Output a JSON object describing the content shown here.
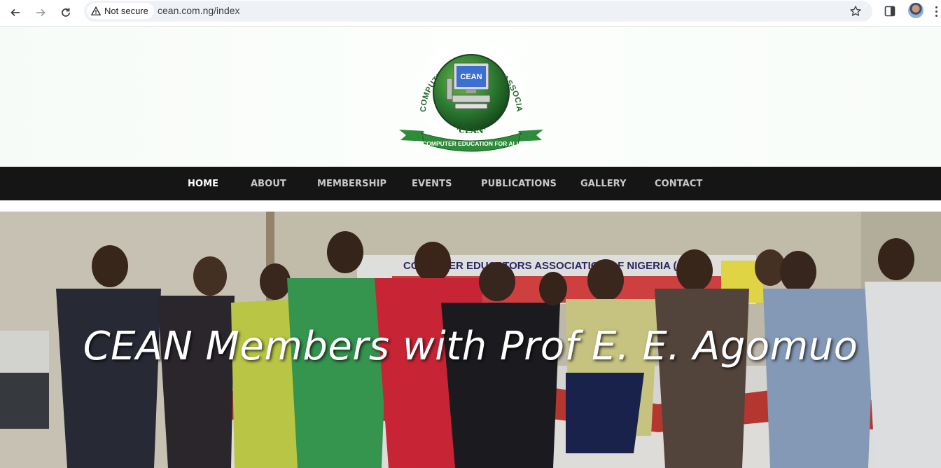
{
  "browser": {
    "security_label": "Not secure",
    "url": "cean.com.ng/index",
    "icons": [
      "back-arrow-icon",
      "forward-arrow-icon",
      "reload-icon",
      "warning-icon",
      "star-icon",
      "side-panel-icon",
      "profile-avatar",
      "kebab-menu-icon"
    ]
  },
  "logo": {
    "ring_text": "COMPUTER EDUCATORS ASSOCIATION OF NIGERIA",
    "center_text": "CEAN",
    "acronym": "'CEAN'",
    "banner_text": "COMPUTER EDUCATION FOR ALL",
    "colors": {
      "green": "#2e7d32",
      "dark_green": "#1b5e20",
      "banner": "#2e8b3a"
    }
  },
  "nav": {
    "items": [
      {
        "label": "HOME",
        "active": true
      },
      {
        "label": "ABOUT",
        "active": false
      },
      {
        "label": "MEMBERSHIP",
        "active": false
      },
      {
        "label": "EVENTS",
        "active": false
      },
      {
        "label": "PUBLICATIONS",
        "active": false
      },
      {
        "label": "GALLERY",
        "active": false
      },
      {
        "label": "CONTACT",
        "active": false
      }
    ],
    "background": "#151515"
  },
  "hero": {
    "caption": "CEAN Members with Prof E. E. Agomuo",
    "banner_text": "COMPUTER EDUCATORS ASSOCIATION OF NIGERIA (CEAN)"
  }
}
